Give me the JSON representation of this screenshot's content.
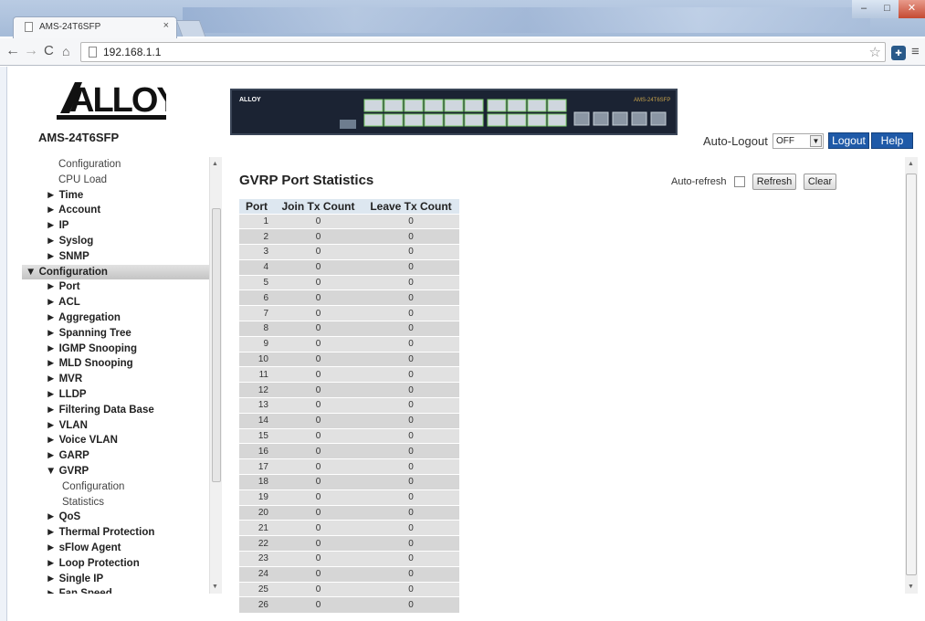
{
  "browser": {
    "tab_title": "AMS-24T6SFP",
    "tab_close": "×",
    "url": "192.168.1.1",
    "window_controls": {
      "minimize": "–",
      "maximize": "□",
      "close": "✕"
    }
  },
  "header": {
    "logo_text": "ALLOY",
    "model": "AMS-24T6SFP",
    "auto_logout_label": "Auto-Logout",
    "auto_logout_value": "OFF",
    "logout_label": "Logout",
    "help_label": "Help"
  },
  "sidebar": {
    "items": [
      {
        "label": "Configuration",
        "level": "sub"
      },
      {
        "label": "CPU Load",
        "level": "sub"
      },
      {
        "label": "► Time",
        "level": "bold"
      },
      {
        "label": "► Account",
        "level": "bold"
      },
      {
        "label": "► IP",
        "level": "bold"
      },
      {
        "label": "► Syslog",
        "level": "bold"
      },
      {
        "label": "► SNMP",
        "level": "bold"
      },
      {
        "label": "▼ Configuration",
        "level": "top"
      },
      {
        "label": "► Port",
        "level": "bold"
      },
      {
        "label": "► ACL",
        "level": "bold"
      },
      {
        "label": "► Aggregation",
        "level": "bold"
      },
      {
        "label": "► Spanning Tree",
        "level": "bold"
      },
      {
        "label": "► IGMP Snooping",
        "level": "bold"
      },
      {
        "label": "► MLD Snooping",
        "level": "bold"
      },
      {
        "label": "► MVR",
        "level": "bold"
      },
      {
        "label": "► LLDP",
        "level": "bold"
      },
      {
        "label": "► Filtering Data Base",
        "level": "bold"
      },
      {
        "label": "► VLAN",
        "level": "bold"
      },
      {
        "label": "► Voice VLAN",
        "level": "bold"
      },
      {
        "label": "► GARP",
        "level": "bold"
      },
      {
        "label": "▼ GVRP",
        "level": "bold"
      },
      {
        "label": "Configuration",
        "level": "sub2"
      },
      {
        "label": "Statistics",
        "level": "sub2"
      },
      {
        "label": "► QoS",
        "level": "bold"
      },
      {
        "label": "► Thermal Protection",
        "level": "bold"
      },
      {
        "label": "► sFlow Agent",
        "level": "bold"
      },
      {
        "label": "► Loop Protection",
        "level": "bold"
      },
      {
        "label": "► Single IP",
        "level": "bold"
      },
      {
        "label": "► Fan Speed",
        "level": "bold"
      }
    ]
  },
  "main": {
    "title": "GVRP Port Statistics",
    "auto_refresh_label": "Auto-refresh",
    "refresh_label": "Refresh",
    "clear_label": "Clear",
    "table": {
      "headers": [
        "Port",
        "Join Tx Count",
        "Leave Tx Count"
      ],
      "rows": [
        [
          "1",
          "0",
          "0"
        ],
        [
          "2",
          "0",
          "0"
        ],
        [
          "3",
          "0",
          "0"
        ],
        [
          "4",
          "0",
          "0"
        ],
        [
          "5",
          "0",
          "0"
        ],
        [
          "6",
          "0",
          "0"
        ],
        [
          "7",
          "0",
          "0"
        ],
        [
          "8",
          "0",
          "0"
        ],
        [
          "9",
          "0",
          "0"
        ],
        [
          "10",
          "0",
          "0"
        ],
        [
          "11",
          "0",
          "0"
        ],
        [
          "12",
          "0",
          "0"
        ],
        [
          "13",
          "0",
          "0"
        ],
        [
          "14",
          "0",
          "0"
        ],
        [
          "15",
          "0",
          "0"
        ],
        [
          "16",
          "0",
          "0"
        ],
        [
          "17",
          "0",
          "0"
        ],
        [
          "18",
          "0",
          "0"
        ],
        [
          "19",
          "0",
          "0"
        ],
        [
          "20",
          "0",
          "0"
        ],
        [
          "21",
          "0",
          "0"
        ],
        [
          "22",
          "0",
          "0"
        ],
        [
          "23",
          "0",
          "0"
        ],
        [
          "24",
          "0",
          "0"
        ],
        [
          "25",
          "0",
          "0"
        ],
        [
          "26",
          "0",
          "0"
        ]
      ]
    }
  },
  "colors": {
    "accent_blue": "#1f5aa8",
    "table_header": "#dde7f0",
    "row_light": "#e1e1e1",
    "row_dark": "#d6d6d6"
  }
}
